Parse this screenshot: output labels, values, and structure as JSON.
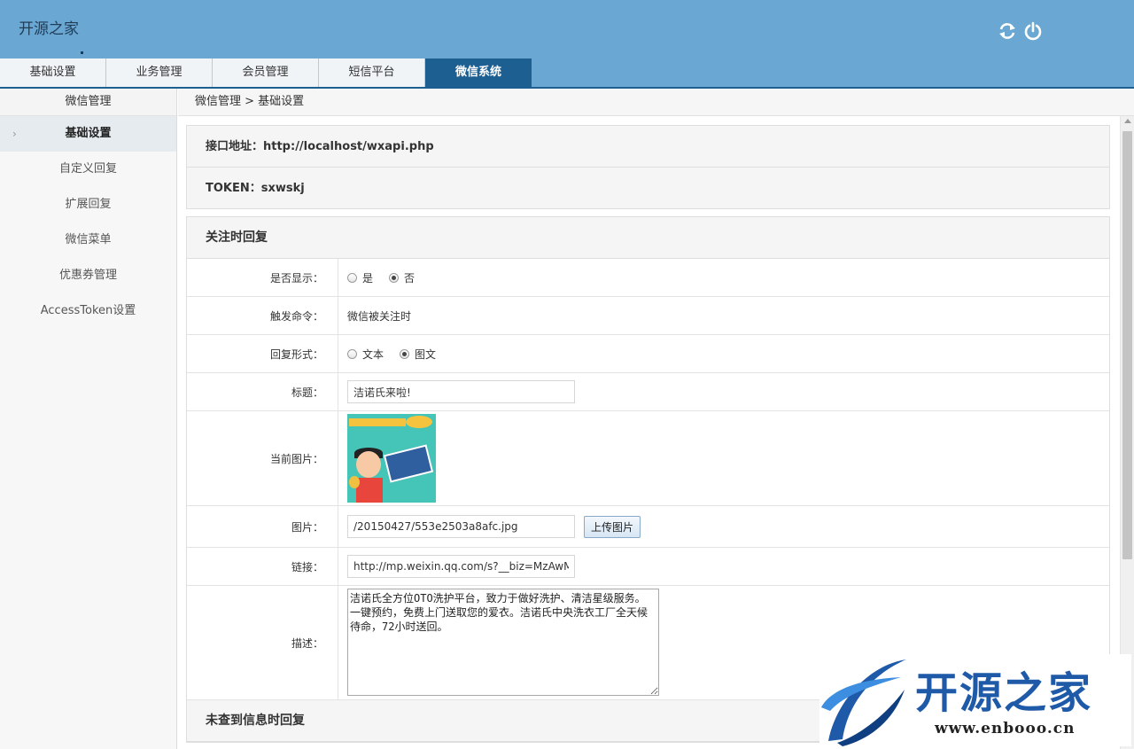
{
  "header": {
    "app_title": "开源之家",
    "icons": [
      "refresh-icon",
      "power-icon"
    ]
  },
  "tabs": [
    {
      "label": "基础设置",
      "active": false
    },
    {
      "label": "业务管理",
      "active": false
    },
    {
      "label": "会员管理",
      "active": false
    },
    {
      "label": "短信平台",
      "active": false
    },
    {
      "label": "微信系统",
      "active": true
    }
  ],
  "sidebar": {
    "heading": "微信管理",
    "items": [
      {
        "label": "基础设置",
        "active": true
      },
      {
        "label": "自定义回复",
        "active": false
      },
      {
        "label": "扩展回复",
        "active": false
      },
      {
        "label": "微信菜单",
        "active": false
      },
      {
        "label": "优惠券管理",
        "active": false
      },
      {
        "label": "AccessToken设置",
        "active": false
      }
    ]
  },
  "breadcrumb": "微信管理 > 基础设置",
  "info": {
    "api_address": "接口地址：http://localhost/wxapi.php",
    "token": "TOKEN：sxwskj"
  },
  "follow_reply": {
    "title": "关注时回复",
    "show_label": "是否显示：",
    "show_options": [
      {
        "label": "是",
        "checked": false
      },
      {
        "label": "否",
        "checked": true
      }
    ],
    "trigger_label": "触发命令：",
    "trigger_value": "微信被关注时",
    "format_label": "回复形式：",
    "format_options": [
      {
        "label": "文本",
        "checked": false
      },
      {
        "label": "图文",
        "checked": true
      }
    ],
    "title_label": "标题：",
    "title_value": "洁诺氏来啦!",
    "current_image_label": "当前图片：",
    "image_label": "图片：",
    "image_value": "/20150427/553e2503a8afc.jpg",
    "upload_label": "上传图片",
    "link_label": "链接：",
    "link_value": "http://mp.weixin.qq.com/s?__biz=MzAwMz",
    "desc_label": "描述：",
    "desc_value": "洁诺氏全方位OTO洗护平台，致力于做好洗护、清洁星级服务。\n一键预约，免费上门送取您的爱衣。洁诺氏中央洗衣工厂全天候待命，72小时送回。"
  },
  "not_found_reply": {
    "title": "未查到信息时回复"
  },
  "watermark": {
    "text": "开源之家",
    "url": "www.enbooo.cn"
  },
  "colors": {
    "header_bg": "#6aa7d3",
    "active_tab": "#1e5f92",
    "watermark_blue": "#1f5aa8"
  }
}
